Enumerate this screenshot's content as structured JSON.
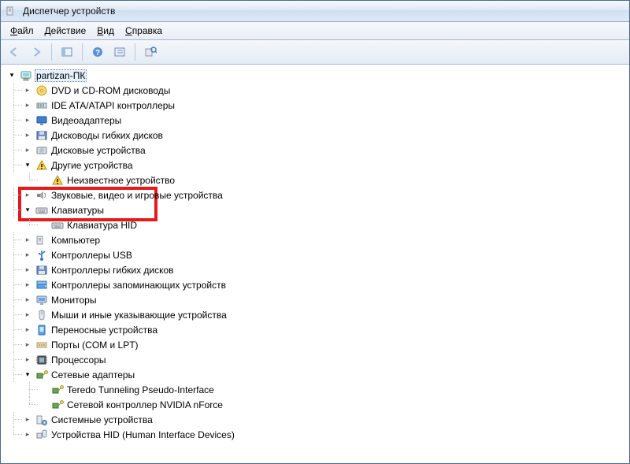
{
  "window": {
    "title": "Диспетчер устройств"
  },
  "menubar": {
    "file": "Файл",
    "action": "Действие",
    "view": "Вид",
    "help": "Справка"
  },
  "root": {
    "label": "partizan-ПК"
  },
  "nodes": {
    "dvd": {
      "label": "DVD и CD-ROM дисководы"
    },
    "ide": {
      "label": "IDE ATA/ATAPI контроллеры"
    },
    "video": {
      "label": "Видеоадаптеры"
    },
    "floppy_drv": {
      "label": "Дисководы гибких дисков"
    },
    "disk": {
      "label": "Дисковые устройства"
    },
    "other": {
      "label": "Другие устройства"
    },
    "unknown": {
      "label": "Неизвестное устройство"
    },
    "sound": {
      "label": "Звуковые, видео и игровые устройства"
    },
    "keyboards": {
      "label": "Клавиатуры"
    },
    "kbd_hid": {
      "label": "Клавиатура HID"
    },
    "computer": {
      "label": "Компьютер"
    },
    "usb": {
      "label": "Контроллеры USB"
    },
    "floppy_ctl": {
      "label": "Контроллеры гибких дисков"
    },
    "storage": {
      "label": "Контроллеры запоминающих устройств"
    },
    "monitors": {
      "label": "Мониторы"
    },
    "mice": {
      "label": "Мыши и иные указывающие устройства"
    },
    "portable": {
      "label": "Переносные устройства"
    },
    "ports": {
      "label": "Порты (COM и LPT)"
    },
    "cpu": {
      "label": "Процессоры"
    },
    "net": {
      "label": "Сетевые адаптеры"
    },
    "teredo": {
      "label": "Teredo Tunneling Pseudo-Interface"
    },
    "nvidia_net": {
      "label": "Сетевой контроллер NVIDIA nForce"
    },
    "system": {
      "label": "Системные устройства"
    },
    "hid": {
      "label": "Устройства HID (Human Interface Devices)"
    }
  },
  "highlight": {
    "color": "#e31b1b"
  }
}
